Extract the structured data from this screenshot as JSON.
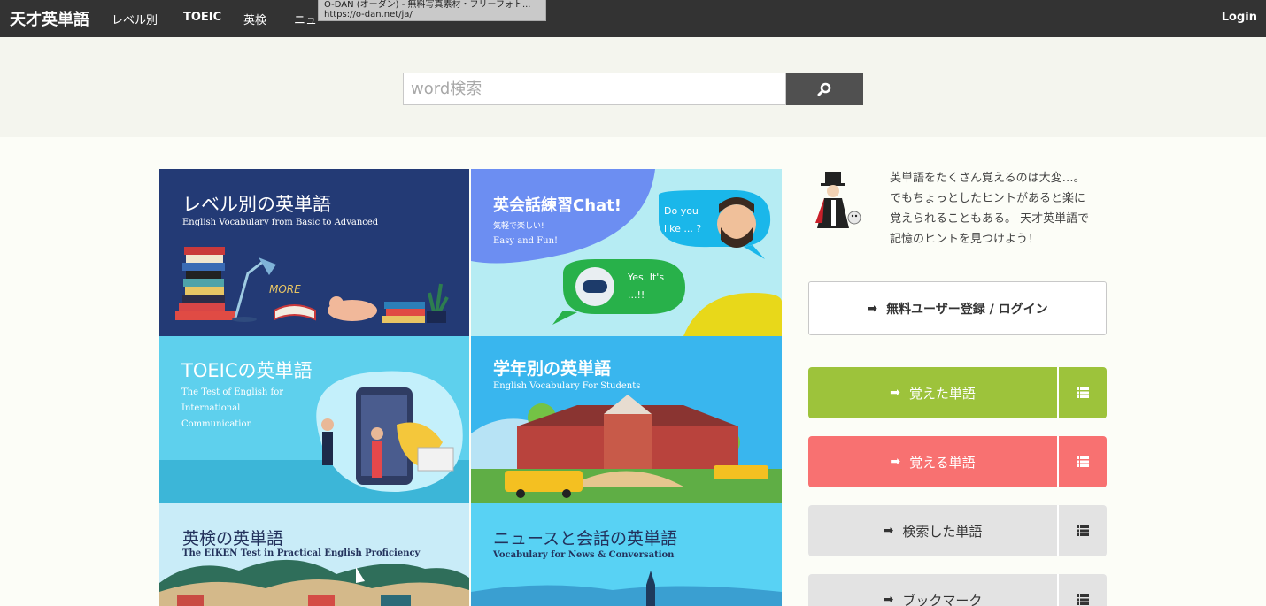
{
  "nav": {
    "brand": "天才英単語",
    "links": [
      "レベル別",
      "TOEIC",
      "英検",
      "ニュー"
    ],
    "login": "Login"
  },
  "tooltip": {
    "title": "O-DAN (オーダン) - 無料写真素材・フリーフォト...",
    "url": "https://o-dan.net/ja/"
  },
  "search": {
    "placeholder": "word検索",
    "value": "",
    "button_icon": "search-icon"
  },
  "tiles": [
    {
      "title": "レベル別の英単語",
      "subtitle": "English Vocabulary from Basic to Advanced",
      "color": "#233a75",
      "art_text": "MORE"
    },
    {
      "title": "英会話練習Chat!",
      "subtitle_1": "気軽で楽しい!",
      "subtitle_2": "Easy and Fun!",
      "bubble_1": "Do you like ... ?",
      "bubble_2": "Yes. It's ...!!",
      "color": "#b6ecf3"
    },
    {
      "title": "TOEICの英単語",
      "subtitle_1": "The Test of English for",
      "subtitle_2": "International",
      "subtitle_3": "Communication",
      "color": "#5ed0ed"
    },
    {
      "title": "学年別の英単語",
      "subtitle": "English Vocabulary For Students",
      "color": "#39b6ee"
    },
    {
      "title": "英検の英単語",
      "subtitle": "The EIKEN Test in Practical English Proficiency",
      "color": "#c9ecf8"
    },
    {
      "title": "ニュースと会話の英単語",
      "subtitle": "Vocabulary for News & Conversation",
      "color": "#58d2f4"
    }
  ],
  "intro": {
    "lines": [
      "英単語をたくさん覚えるのは大変…。",
      "でもちょっとしたヒントがあると楽に",
      "覚えられることもある。 天才英単語で",
      "記憶のヒントを見つけよう！"
    ]
  },
  "register": {
    "label": "無料ユーザー登録 / ログイン"
  },
  "word_buttons": [
    {
      "label": "覚えた単語",
      "color": "#9dc33b",
      "text_color": "#ffffff"
    },
    {
      "label": "覚える単語",
      "color": "#f87171",
      "text_color": "#ffffff"
    },
    {
      "label": "検索した単語",
      "color": "#e3e3e3",
      "text_color": "#333333"
    },
    {
      "label": "ブックマーク",
      "color": "#e3e3e3",
      "text_color": "#333333"
    }
  ]
}
